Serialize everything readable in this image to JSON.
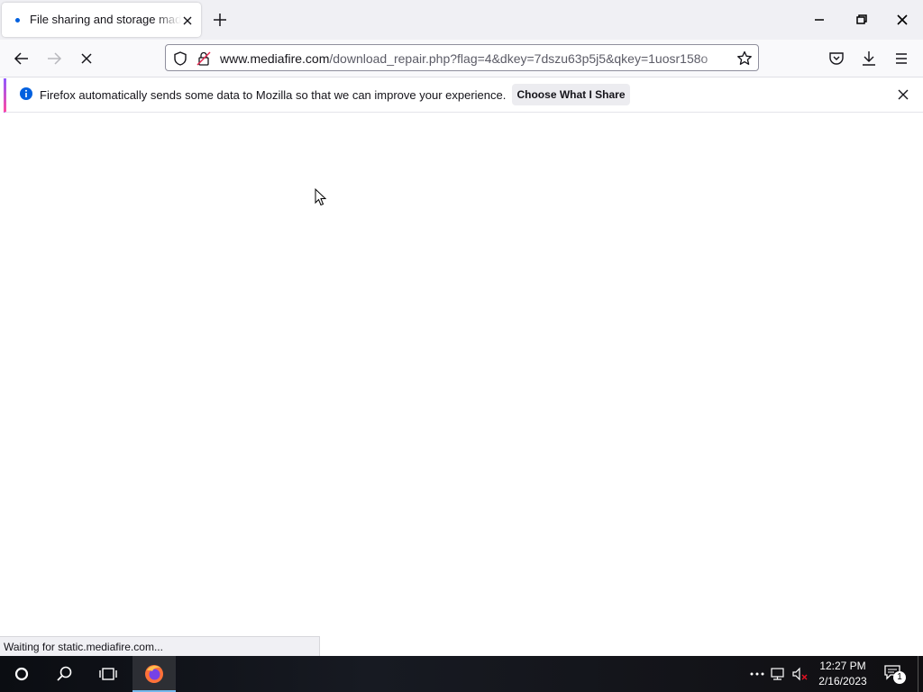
{
  "browser": {
    "tab": {
      "title": "File sharing and storage made simple"
    },
    "url": {
      "host": "www.mediafire.com",
      "path": "/download_repair.php?flag=4&dkey=7dszu63p5j5&qkey=1uosr158o"
    }
  },
  "notification": {
    "message": "Firefox automatically sends some data to Mozilla so that we can improve your experience.",
    "button_label": "Choose What I Share"
  },
  "status": {
    "text": "Waiting for static.mediafire.com..."
  },
  "taskbar": {
    "time": "12:27 PM",
    "date": "2/16/2023",
    "notification_count": "1"
  },
  "colors": {
    "accent": "#0060df",
    "notification_stripe": "#b833e1",
    "taskbar": "#0b0d12"
  },
  "icons": [
    "close-icon",
    "plus-icon",
    "minimize-icon",
    "restore-icon",
    "back-icon",
    "forward-icon",
    "stop-icon",
    "shield-icon",
    "lock-icon",
    "star-icon",
    "pocket-icon",
    "download-icon",
    "menu-icon",
    "info-icon",
    "windows-start-icon",
    "search-icon",
    "task-view-icon",
    "firefox-icon",
    "network-icon",
    "volume-muted-icon",
    "action-center-icon"
  ]
}
